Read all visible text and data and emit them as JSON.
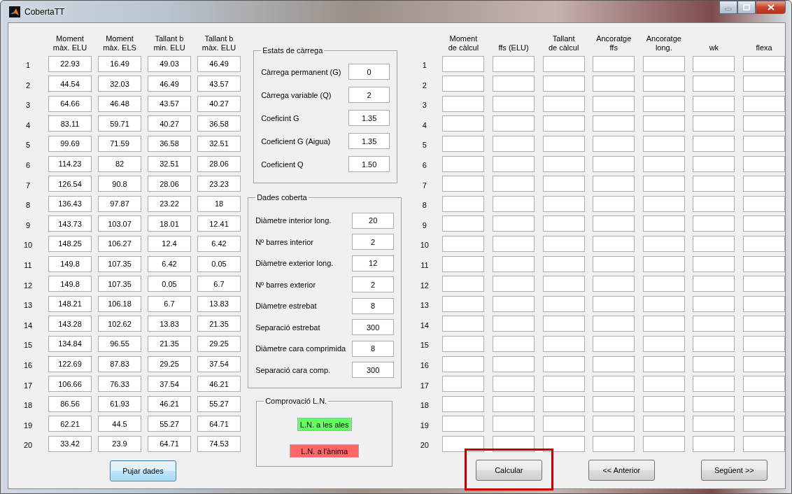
{
  "window": {
    "title": "CobertaTT"
  },
  "left_table": {
    "columns": [
      "Moment\nmàx. ELU",
      "Moment\nmàx. ELS",
      "Tallant b\nmin. ELU",
      "Tallant b\nmàx. ELU"
    ],
    "rows": [
      {
        "number": "1",
        "cells": [
          "22.93",
          "16.49",
          "49.03",
          "46.49"
        ]
      },
      {
        "number": "2",
        "cells": [
          "44.54",
          "32.03",
          "46.49",
          "43.57"
        ]
      },
      {
        "number": "3",
        "cells": [
          "64.66",
          "46.48",
          "43.57",
          "40.27"
        ]
      },
      {
        "number": "4",
        "cells": [
          "83.11",
          "59.71",
          "40.27",
          "36.58"
        ]
      },
      {
        "number": "5",
        "cells": [
          "99.69",
          "71.59",
          "36.58",
          "32.51"
        ]
      },
      {
        "number": "6",
        "cells": [
          "114.23",
          "82",
          "32.51",
          "28.06"
        ]
      },
      {
        "number": "7",
        "cells": [
          "126.54",
          "90.8",
          "28.06",
          "23.23"
        ]
      },
      {
        "number": "8",
        "cells": [
          "136.43",
          "97.87",
          "23.22",
          "18"
        ]
      },
      {
        "number": "9",
        "cells": [
          "143.73",
          "103.07",
          "18.01",
          "12.41"
        ]
      },
      {
        "number": "10",
        "cells": [
          "148.25",
          "106.27",
          "12.4",
          "6.42"
        ]
      },
      {
        "number": "11",
        "cells": [
          "149.8",
          "107.35",
          "6.42",
          "0.05"
        ]
      },
      {
        "number": "12",
        "cells": [
          "149.8",
          "107.35",
          "0.05",
          "6.7"
        ]
      },
      {
        "number": "13",
        "cells": [
          "148.21",
          "106.18",
          "6.7",
          "13.83"
        ]
      },
      {
        "number": "14",
        "cells": [
          "143.28",
          "102.62",
          "13.83",
          "21.35"
        ]
      },
      {
        "number": "15",
        "cells": [
          "134.84",
          "96.55",
          "21.35",
          "29.25"
        ]
      },
      {
        "number": "16",
        "cells": [
          "122.69",
          "87.83",
          "29.25",
          "37.54"
        ]
      },
      {
        "number": "17",
        "cells": [
          "106.66",
          "76.33",
          "37.54",
          "46.21"
        ]
      },
      {
        "number": "18",
        "cells": [
          "86.56",
          "61.93",
          "46.21",
          "55.27"
        ]
      },
      {
        "number": "19",
        "cells": [
          "62.21",
          "44.5",
          "55.27",
          "64.71"
        ]
      },
      {
        "number": "20",
        "cells": [
          "33.42",
          "23.9",
          "64.71",
          "74.53"
        ]
      }
    ]
  },
  "load_panel": {
    "title": "Estats de càrrega",
    "fields": [
      {
        "label": "Càrrega permanent (G)",
        "value": "0"
      },
      {
        "label": "Càrrega variable (Q)",
        "value": "2"
      },
      {
        "label": "Coeficint G",
        "value": "1.35"
      },
      {
        "label": "Coeficient G (Aigua)",
        "value": "1.35"
      },
      {
        "label": "Coeficient Q",
        "value": "1.50"
      }
    ]
  },
  "roof_panel": {
    "title": "Dades coberta",
    "fields": [
      {
        "label": "Diàmetre interior long.",
        "value": "20"
      },
      {
        "label": "Nº barres interior",
        "value": "2"
      },
      {
        "label": "Diàmetre exterior long.",
        "value": "12"
      },
      {
        "label": "Nº barres exterior",
        "value": "2"
      },
      {
        "label": "Diàmetre estrebat",
        "value": "8"
      },
      {
        "label": "Separació estrebat",
        "value": "300"
      },
      {
        "label": "Diàmetre cara comprimida",
        "value": "8"
      },
      {
        "label": "Separació cara comp.",
        "value": "300"
      }
    ]
  },
  "check_panel": {
    "title": "Comprovació L.N.",
    "indicators": [
      {
        "label": "L.N. a les ales",
        "color": "#66ff66"
      },
      {
        "label": "L.N. a l'ànima",
        "color": "#ff6666"
      }
    ]
  },
  "right_table": {
    "columns": [
      "Moment\nde càlcul",
      "ffs (ELU)",
      "Tallant\nde càlcul",
      "Ancoratge\nffs",
      "Ancoratge\nlong.",
      "wk",
      "flexa"
    ],
    "rows": [
      "1",
      "2",
      "3",
      "4",
      "5",
      "6",
      "7",
      "8",
      "9",
      "10",
      "11",
      "12",
      "13",
      "14",
      "15",
      "16",
      "17",
      "18",
      "19",
      "20"
    ]
  },
  "left_buttons": [
    {
      "label": "Pujar dades",
      "focused": true,
      "highlighted": false
    }
  ],
  "right_buttons": [
    {
      "label": "Calcular",
      "focused": false,
      "highlighted": true
    },
    {
      "label": "<< Anterior",
      "focused": false,
      "highlighted": false
    },
    {
      "label": "Següent >>",
      "focused": false,
      "highlighted": false
    }
  ]
}
